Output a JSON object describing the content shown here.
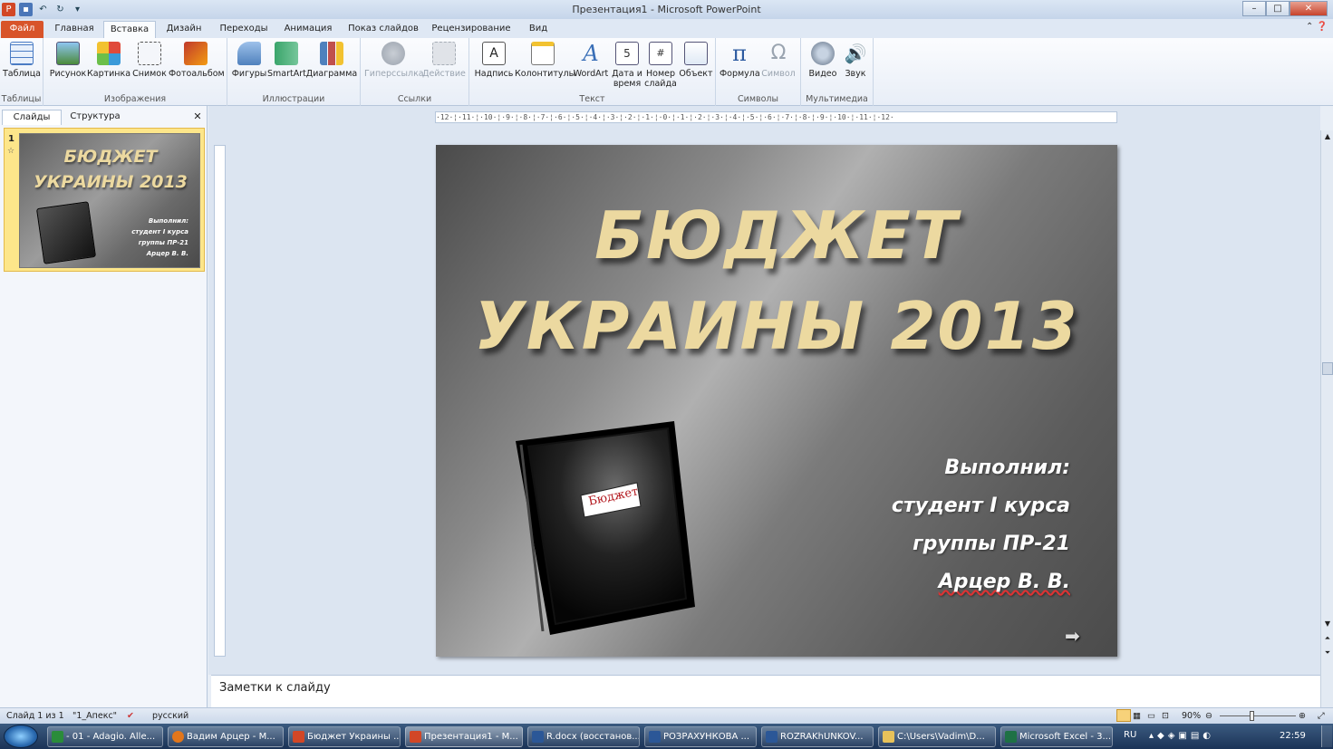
{
  "window": {
    "title": "Презентация1  -  Microsoft PowerPoint",
    "controls": [
      "–",
      "□",
      "✕"
    ]
  },
  "qat": {
    "app_icon": "P"
  },
  "tabs": [
    {
      "label": "Файл"
    },
    {
      "label": "Главная"
    },
    {
      "label": "Вставка"
    },
    {
      "label": "Дизайн"
    },
    {
      "label": "Переходы"
    },
    {
      "label": "Анимация"
    },
    {
      "label": "Показ слайдов"
    },
    {
      "label": "Рецензирование"
    },
    {
      "label": "Вид"
    }
  ],
  "active_tab": "Вставка",
  "ribbon": {
    "groups": [
      {
        "label": "Таблицы",
        "buttons": [
          {
            "label": "Таблица",
            "icon": "table-icon"
          }
        ]
      },
      {
        "label": "Изображения",
        "buttons": [
          {
            "label": "Рисунок",
            "icon": "picture-icon"
          },
          {
            "label": "Картинка",
            "icon": "clipart-icon"
          },
          {
            "label": "Снимок",
            "icon": "screenshot-icon"
          },
          {
            "label": "Фотоальбом",
            "icon": "photo-album-icon"
          }
        ]
      },
      {
        "label": "Иллюстрации",
        "buttons": [
          {
            "label": "Фигуры",
            "icon": "shapes-icon"
          },
          {
            "label": "SmartArt",
            "icon": "smartart-icon"
          },
          {
            "label": "Диаграмма",
            "icon": "chart-icon"
          }
        ]
      },
      {
        "label": "Ссылки",
        "buttons": [
          {
            "label": "Гиперссылка",
            "icon": "hyperlink-icon",
            "disabled": true
          },
          {
            "label": "Действие",
            "icon": "action-icon",
            "disabled": true
          }
        ]
      },
      {
        "label": "Текст",
        "buttons": [
          {
            "label": "Надпись",
            "icon": "textbox-icon"
          },
          {
            "label": "Колонтитулы",
            "icon": "header-footer-icon"
          },
          {
            "label": "WordArt",
            "icon": "wordart-icon"
          },
          {
            "label": "Дата и время",
            "icon": "date-time-icon"
          },
          {
            "label": "Номер слайда",
            "icon": "slide-number-icon"
          },
          {
            "label": "Объект",
            "icon": "object-icon"
          }
        ]
      },
      {
        "label": "Символы",
        "buttons": [
          {
            "label": "Формула",
            "icon": "equation-icon"
          },
          {
            "label": "Символ",
            "icon": "symbol-icon",
            "disabled": true
          }
        ]
      },
      {
        "label": "Мультимедиа",
        "buttons": [
          {
            "label": "Видео",
            "icon": "video-icon"
          },
          {
            "label": "Звук",
            "icon": "audio-icon"
          }
        ]
      }
    ]
  },
  "left_pane": {
    "tabs": [
      "Слайды",
      "Структура"
    ],
    "close": "✕",
    "slide_number": "1",
    "thumb": {
      "title_line1": "БЮДЖЕТ",
      "title_line2": "УКРАИНЫ 2013",
      "lines": [
        "Выполнил:",
        "студент I курса",
        "группы ПР-21",
        "Арцер В. В."
      ]
    }
  },
  "ruler": {
    "text": "·12·¦·11·¦·10·¦·9·¦·8·¦·7·¦·6·¦·5·¦·4·¦·3·¦·2·¦·1·¦·0·¦·1·¦·2·¦·3·¦·4·¦·5·¦·6·¦·7·¦·8·¦·9·¦·10·¦·11·¦·12·"
  },
  "slide": {
    "title_line1": "БЮДЖЕТ",
    "title_line2": "УКРАИНЫ 2013",
    "subtitle": [
      "Выполнил:",
      "студент I курса",
      "группы ПР-21",
      "Арцер В. В."
    ],
    "book_label": "Бюджет"
  },
  "notes": {
    "placeholder": "Заметки к слайду"
  },
  "status": {
    "slide_info": "Слайд 1 из 1",
    "theme": "\"1_Апекс\"",
    "language": "русский",
    "zoom": "90%"
  },
  "taskbar": {
    "items": [
      {
        "label": "- 01 - Adagio. Alle...",
        "color": "#2a8c3a"
      },
      {
        "label": "Вадим Арцер - М...",
        "color": "#e2761b"
      },
      {
        "label": "Бюджет Украины ...",
        "color": "#d24726"
      },
      {
        "label": "Презентация1 - М...",
        "color": "#d24726"
      },
      {
        "label": "R.docx (восстанов...",
        "color": "#2b5797"
      },
      {
        "label": "РОЗРАХУНКОВА ...",
        "color": "#2b5797"
      },
      {
        "label": "ROZRAKhUNKOV...",
        "color": "#2b5797"
      },
      {
        "label": "C:\\Users\\Vadim\\D...",
        "color": "#e8c25a"
      },
      {
        "label": "Microsoft Excel - 3...",
        "color": "#1e7145"
      }
    ],
    "lang": "RU",
    "clock": "22:59"
  }
}
